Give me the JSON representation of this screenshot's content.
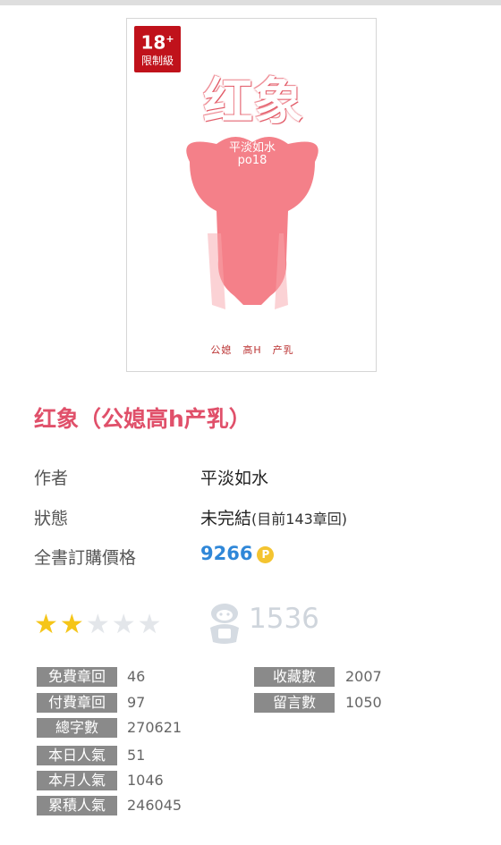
{
  "cover": {
    "badge_num": "18",
    "badge_plus": "+",
    "badge_text": "限制級",
    "title": "红象",
    "author": "平淡如水",
    "site": "po18",
    "tags": "公媳　高H　产乳"
  },
  "book": {
    "title": "红象（公媳高h产乳）"
  },
  "info": {
    "author_label": "作者",
    "author_value": "平淡如水",
    "status_label": "狀態",
    "status_value": "未完結",
    "status_sub": "(目前143章回)",
    "price_label": "全書訂購價格",
    "price_value": "9266",
    "coin_icon": "P"
  },
  "rating": {
    "stars_filled": 2,
    "stars_total": 5,
    "fans_count": "1536"
  },
  "stats": {
    "free_label": "免費章回",
    "free_value": "46",
    "paid_label": "付費章回",
    "paid_value": "97",
    "words_label": "總字數",
    "words_value": "270621",
    "today_label": "本日人氣",
    "today_value": "51",
    "month_label": "本月人氣",
    "month_value": "1046",
    "total_label": "累積人氣",
    "total_value": "246045",
    "fav_label": "收藏數",
    "fav_value": "2007",
    "comment_label": "留言數",
    "comment_value": "1050"
  },
  "colors": {
    "title_pink": "#e0506a",
    "price_blue": "#2f87d8",
    "badge_red": "#c0121b",
    "star_gold": "#f5c518"
  }
}
